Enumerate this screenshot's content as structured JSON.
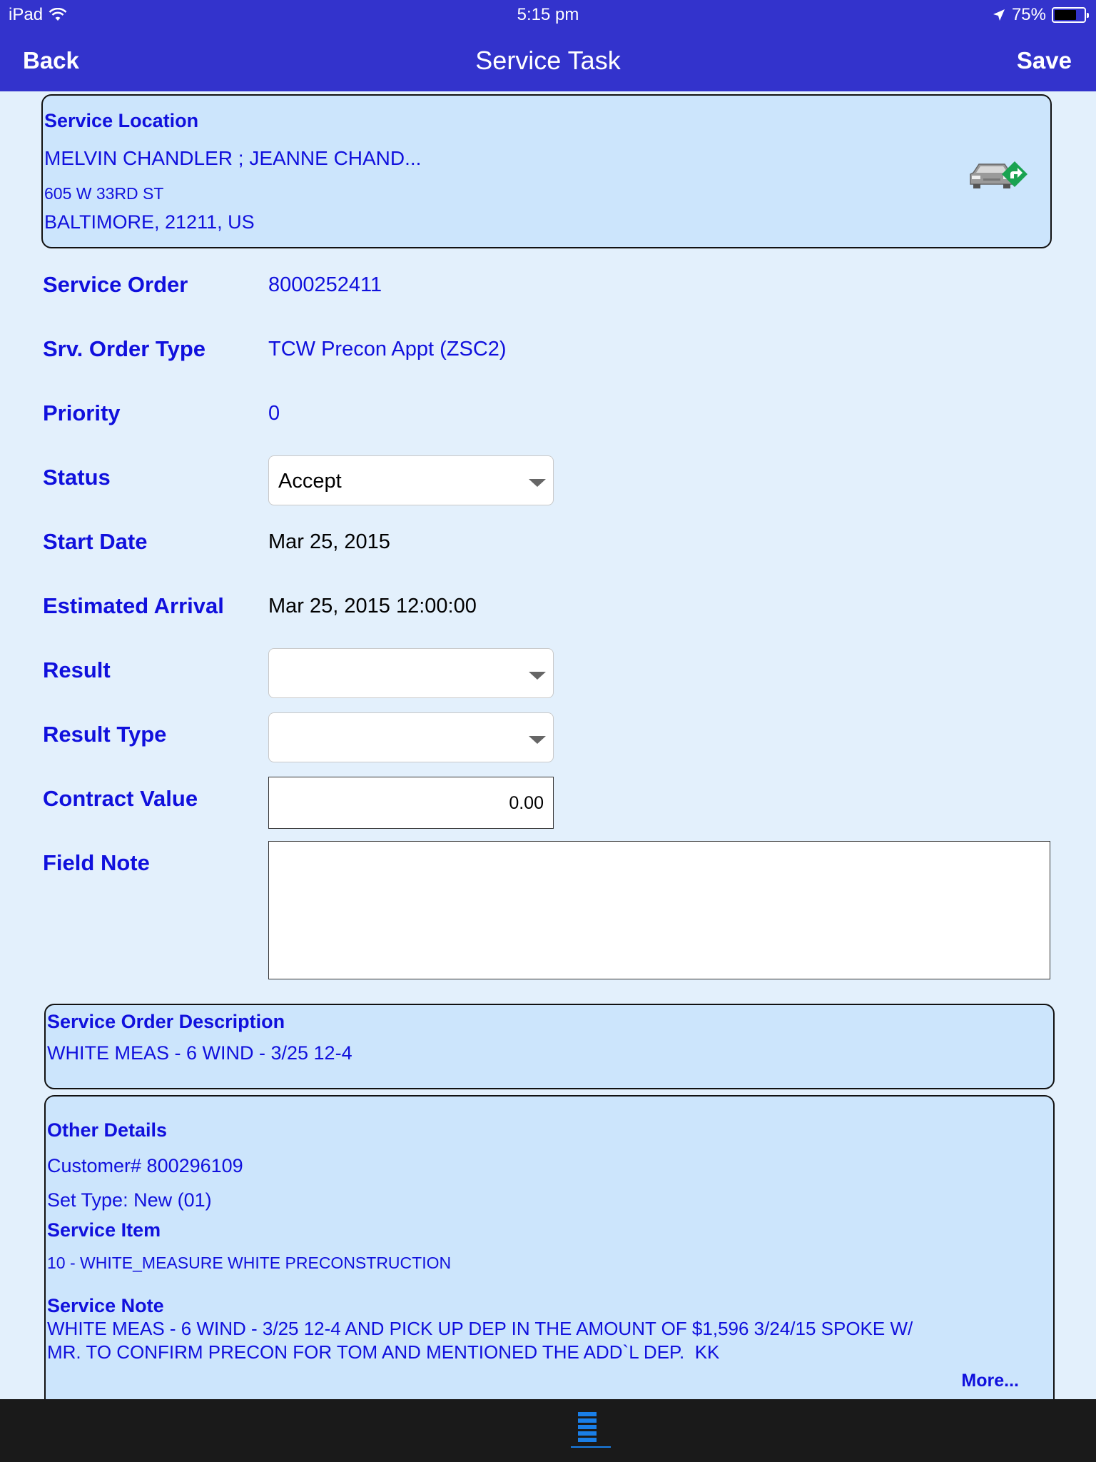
{
  "status_bar": {
    "device": "iPad",
    "time": "5:15 pm",
    "battery": "75%",
    "battery_level": 0.75
  },
  "nav": {
    "back_label": "Back",
    "title": "Service Task",
    "save_label": "Save"
  },
  "location": {
    "heading": "Service Location",
    "name": "MELVIN CHANDLER ; JEANNE CHAND...",
    "street": "605 W 33RD ST",
    "city": "BALTIMORE, 21211, US"
  },
  "fields": {
    "service_order": {
      "label": "Service Order",
      "value": "8000252411"
    },
    "order_type": {
      "label": "Srv. Order Type",
      "value": "TCW Precon Appt (ZSC2)"
    },
    "priority": {
      "label": "Priority",
      "value": "0"
    },
    "status": {
      "label": "Status",
      "value": "Accept"
    },
    "start_date": {
      "label": "Start Date",
      "value": "Mar 25, 2015"
    },
    "estimated_arrival": {
      "label": "Estimated Arrival",
      "value": "Mar 25, 2015 12:00:00"
    },
    "result": {
      "label": "Result",
      "value": ""
    },
    "result_type": {
      "label": "Result Type",
      "value": ""
    },
    "contract_value": {
      "label": "Contract Value",
      "value": "0.00"
    },
    "field_note": {
      "label": "Field Note",
      "value": ""
    }
  },
  "description": {
    "heading": "Service Order Description",
    "text": "WHITE MEAS - 6 WIND - 3/25 12-4"
  },
  "other_details": {
    "heading": "Other Details",
    "customer": "Customer# 800296109",
    "set_type": "Set Type: New (01)",
    "service_item_heading": "Service Item",
    "service_item": "10 - WHITE_MEASURE WHITE PRECONSTRUCTION",
    "service_note_heading": "Service Note",
    "service_note_line1": "WHITE MEAS - 6 WIND - 3/25 12-4 AND PICK UP DEP IN THE AMOUNT OF $1,596 3/24/15 SPOKE W/",
    "service_note_line2": "MR. TO CONFIRM PRECON FOR TOM AND MENTIONED THE ADD`L DEP.  KK",
    "more_label": "More..."
  },
  "icons": {
    "navigate": "car-directions-icon",
    "tab": "list-icon"
  },
  "colors": {
    "header": "#3333cc",
    "label": "#1010dd",
    "panel": "#cce5fc",
    "background": "#e3f0fc",
    "tabbar": "#1a1a1a",
    "tab_active": "#1a7fe8"
  }
}
